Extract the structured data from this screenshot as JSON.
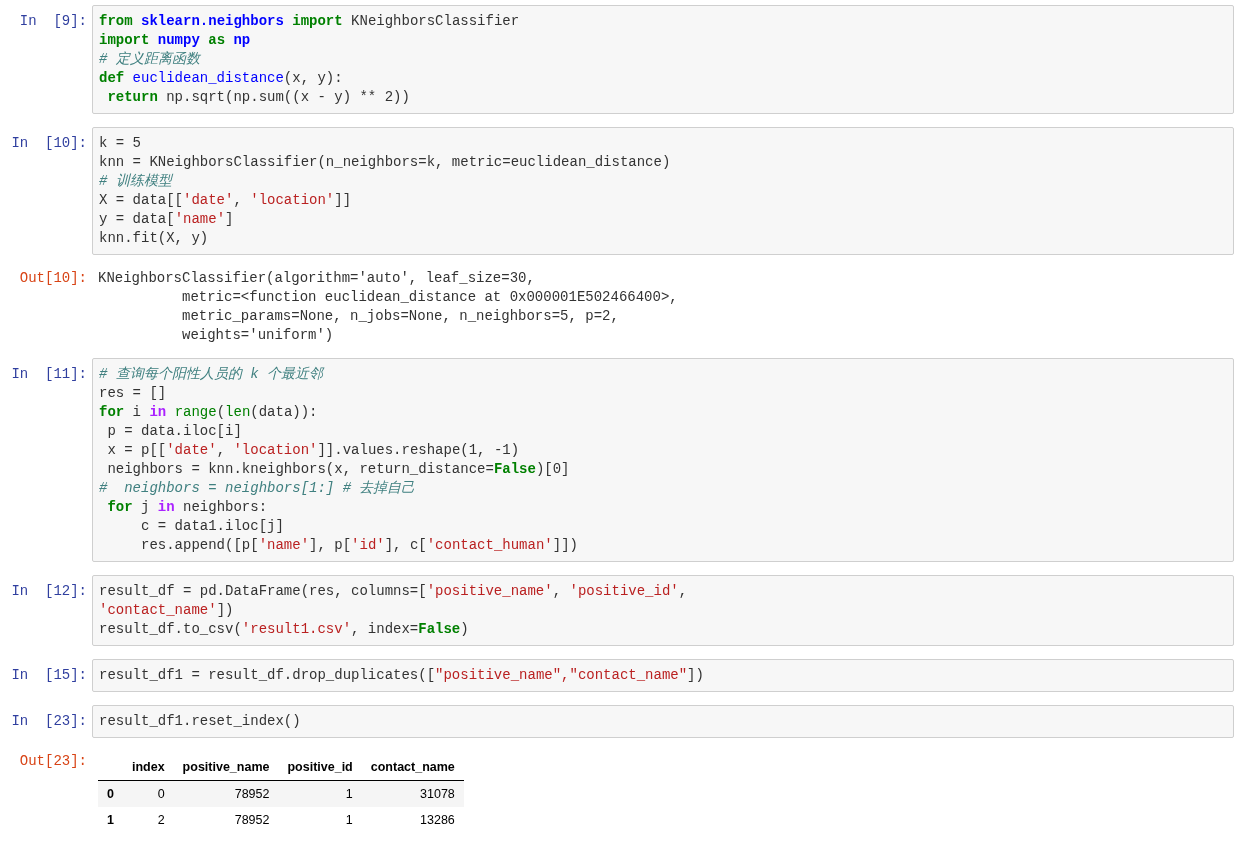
{
  "cells": [
    {
      "kind": "input",
      "prompt": "In  [9]:",
      "lines": [
        [
          {
            "kind": "kw",
            "text": "from "
          },
          {
            "kind": "ns",
            "text": "sklearn.neighbors "
          },
          {
            "kind": "kw",
            "text": "import"
          },
          {
            "kind": "plain",
            "text": " KNeighborsClassifier"
          }
        ],
        [
          {
            "kind": "kw",
            "text": "import "
          },
          {
            "kind": "ns",
            "text": "numpy "
          },
          {
            "kind": "kw",
            "text": "as "
          },
          {
            "kind": "ns",
            "text": "np"
          }
        ],
        [
          {
            "kind": "comment",
            "text": "# 定义距离函数"
          }
        ],
        [
          {
            "kind": "kw",
            "text": "def "
          },
          {
            "kind": "fn",
            "text": "euclidean_distance"
          },
          {
            "kind": "plain",
            "text": "(x, y):"
          }
        ],
        [
          {
            "kind": "kw",
            "text": " return"
          },
          {
            "kind": "plain",
            "text": " np.sqrt(np.sum((x - y) ** 2))"
          }
        ]
      ]
    },
    {
      "kind": "input",
      "prompt": "In  [10]:",
      "lines": [
        [
          {
            "kind": "plain",
            "text": "k = 5"
          }
        ],
        [
          {
            "kind": "plain",
            "text": "knn = KNeighborsClassifier(n_neighbors=k, metric=euclidean_distance)"
          }
        ],
        [
          {
            "kind": "comment",
            "text": "# 训练模型"
          }
        ],
        [
          {
            "kind": "plain",
            "text": "X = data[["
          },
          {
            "kind": "str",
            "text": "'date'"
          },
          {
            "kind": "plain",
            "text": ", "
          },
          {
            "kind": "str",
            "text": "'location'"
          },
          {
            "kind": "plain",
            "text": "]]"
          }
        ],
        [
          {
            "kind": "plain",
            "text": "y = data["
          },
          {
            "kind": "str",
            "text": "'name'"
          },
          {
            "kind": "plain",
            "text": "]"
          }
        ],
        [
          {
            "kind": "plain",
            "text": "knn.fit(X, y)"
          }
        ]
      ]
    },
    {
      "kind": "output",
      "prompt": "Out[10]:",
      "lines": [
        "KNeighborsClassifier(algorithm='auto', leaf_size=30,",
        "          metric=<function euclidean_distance at 0x000001E502466400>,",
        "          metric_params=None, n_jobs=None, n_neighbors=5, p=2,",
        "          weights='uniform')"
      ]
    },
    {
      "kind": "input",
      "prompt": "In  [11]:",
      "lines": [
        [
          {
            "kind": "comment",
            "text": "# 查询每个阳性人员的 k 个最近邻"
          }
        ],
        [
          {
            "kind": "plain",
            "text": "res = []"
          }
        ],
        [
          {
            "kind": "kw",
            "text": "for"
          },
          {
            "kind": "plain",
            "text": " i "
          },
          {
            "kind": "op",
            "text": "in "
          },
          {
            "kind": "builtin",
            "text": "range"
          },
          {
            "kind": "plain",
            "text": "("
          },
          {
            "kind": "builtin",
            "text": "len"
          },
          {
            "kind": "plain",
            "text": "(data)):"
          }
        ],
        [
          {
            "kind": "plain",
            "text": " p = data.iloc[i]"
          }
        ],
        [
          {
            "kind": "plain",
            "text": " x = p[["
          },
          {
            "kind": "str",
            "text": "'date'"
          },
          {
            "kind": "plain",
            "text": ", "
          },
          {
            "kind": "str",
            "text": "'location'"
          },
          {
            "kind": "plain",
            "text": "]].values.reshape(1, -1)"
          }
        ],
        [
          {
            "kind": "plain",
            "text": " neighbors = knn.kneighbors(x, return_distance="
          },
          {
            "kind": "kw",
            "text": "False"
          },
          {
            "kind": "plain",
            "text": ")[0]"
          }
        ],
        [
          {
            "kind": "comment",
            "text": "#  neighbors = neighbors[1:] # 去掉自己"
          }
        ],
        [
          {
            "kind": "kw",
            "text": " for"
          },
          {
            "kind": "plain",
            "text": " j "
          },
          {
            "kind": "op",
            "text": "in"
          },
          {
            "kind": "plain",
            "text": " neighbors:"
          }
        ],
        [
          {
            "kind": "plain",
            "text": "     c = data1.iloc[j]"
          }
        ],
        [
          {
            "kind": "plain",
            "text": "     res.append([p["
          },
          {
            "kind": "str",
            "text": "'name'"
          },
          {
            "kind": "plain",
            "text": "], p["
          },
          {
            "kind": "str",
            "text": "'id'"
          },
          {
            "kind": "plain",
            "text": "], c["
          },
          {
            "kind": "str",
            "text": "'contact_human'"
          },
          {
            "kind": "plain",
            "text": "]])"
          }
        ]
      ]
    },
    {
      "kind": "input",
      "prompt": "In  [12]:",
      "lines": [
        [
          {
            "kind": "plain",
            "text": "result_df = pd.DataFrame(res, columns=["
          },
          {
            "kind": "str",
            "text": "'positive_name'"
          },
          {
            "kind": "plain",
            "text": ", "
          },
          {
            "kind": "str",
            "text": "'positive_id'"
          },
          {
            "kind": "plain",
            "text": ","
          }
        ],
        [
          {
            "kind": "str",
            "text": "'contact_name'"
          },
          {
            "kind": "plain",
            "text": "])"
          }
        ],
        [
          {
            "kind": "plain",
            "text": "result_df.to_csv("
          },
          {
            "kind": "str",
            "text": "'result1.csv'"
          },
          {
            "kind": "plain",
            "text": ", index="
          },
          {
            "kind": "kw",
            "text": "False"
          },
          {
            "kind": "plain",
            "text": ")"
          }
        ]
      ]
    },
    {
      "kind": "input",
      "prompt": "In  [15]:",
      "lines": [
        [
          {
            "kind": "plain",
            "text": "result_df1 = result_df.drop_duplicates(["
          },
          {
            "kind": "str",
            "text": "\"positive_name\","
          },
          {
            "kind": "str",
            "text": "\"contact_name\""
          },
          {
            "kind": "plain",
            "text": "])"
          }
        ]
      ]
    },
    {
      "kind": "input",
      "prompt": "In  [23]:",
      "lines": [
        [
          {
            "kind": "plain",
            "text": "result_df1.reset_index()"
          }
        ]
      ]
    },
    {
      "kind": "table",
      "prompt": "Out[23]:",
      "columns": [
        "index",
        "positive_name",
        "positive_id",
        "contact_name"
      ],
      "rows": [
        {
          "label": "0",
          "cells": [
            "0",
            "78952",
            "1",
            "31078"
          ]
        },
        {
          "label": "1",
          "cells": [
            "2",
            "78952",
            "1",
            "13286"
          ]
        }
      ]
    }
  ]
}
